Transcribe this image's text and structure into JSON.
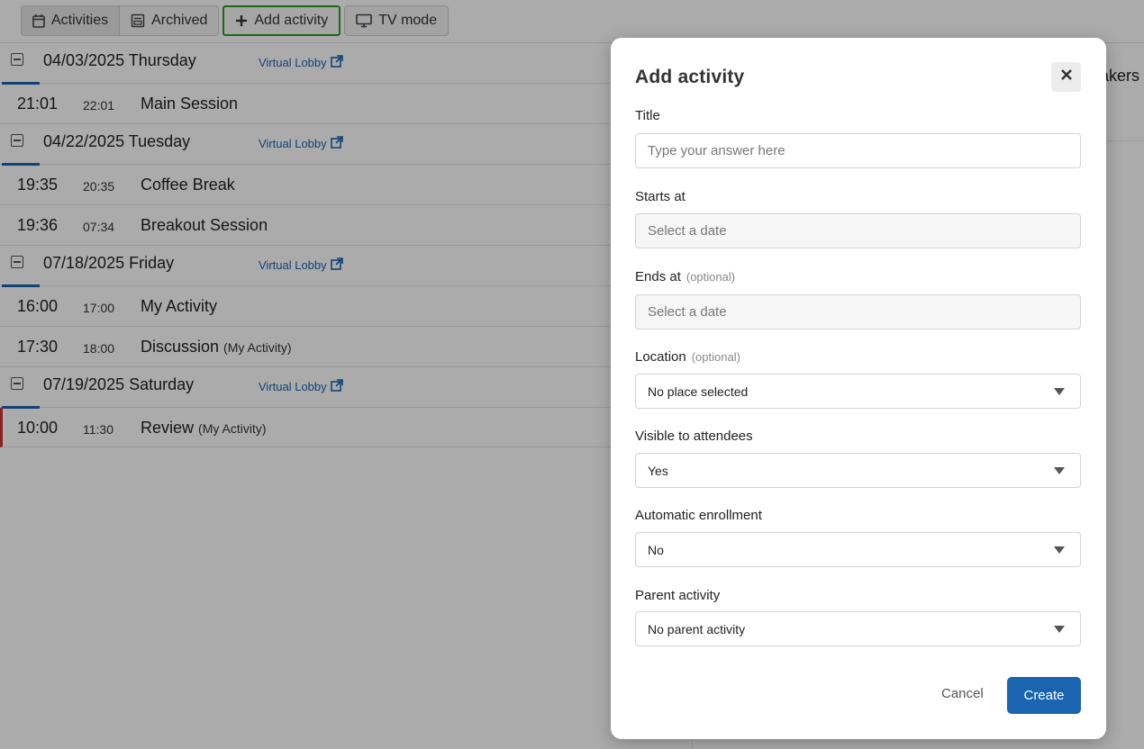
{
  "toolbar": {
    "activities_label": "Activities",
    "archived_label": "Archived",
    "add_activity_label": "Add activity",
    "tv_mode_label": "TV mode"
  },
  "days": [
    {
      "date": "04/03/2025 Thursday",
      "lobby": "Virtual Lobby",
      "activities": [
        {
          "start": "21:01",
          "end": "22:01",
          "name": "Main Session",
          "parent": ""
        }
      ]
    },
    {
      "date": "04/22/2025 Tuesday",
      "lobby": "Virtual Lobby",
      "activities": [
        {
          "start": "19:35",
          "end": "20:35",
          "name": "Coffee Break",
          "parent": ""
        },
        {
          "start": "19:36",
          "end": "07:34",
          "name": "Breakout Session",
          "parent": ""
        }
      ]
    },
    {
      "date": "07/18/2025 Friday",
      "lobby": "Virtual Lobby",
      "activities": [
        {
          "start": "16:00",
          "end": "17:00",
          "name": "My Activity",
          "parent": ""
        },
        {
          "start": "17:30",
          "end": "18:00",
          "name": "Discussion",
          "parent": "(My Activity)"
        }
      ]
    },
    {
      "date": "07/19/2025 Saturday",
      "lobby": "Virtual Lobby",
      "activities": [
        {
          "start": "10:00",
          "end": "11:30",
          "name": "Review",
          "parent": "(My Activity)"
        }
      ]
    }
  ],
  "right_panel": {
    "speakers_partial": "akers"
  },
  "modal": {
    "title": "Add activity",
    "title_label": "Title",
    "title_placeholder": "Type your answer here",
    "starts_label": "Starts at",
    "starts_placeholder": "Select a date",
    "ends_label": "Ends at",
    "optional_text": "(optional)",
    "ends_placeholder": "Select a date",
    "location_label": "Location",
    "location_value": "No place selected",
    "visible_label": "Visible to attendees",
    "visible_value": "Yes",
    "enroll_label": "Automatic enrollment",
    "enroll_value": "No",
    "parent_label": "Parent activity",
    "parent_value": "No parent activity",
    "cancel_label": "Cancel",
    "create_label": "Create"
  },
  "colors": {
    "accent": "#1a64b0",
    "highlight_border": "#2a9d2a",
    "current_marker": "#d03030"
  }
}
